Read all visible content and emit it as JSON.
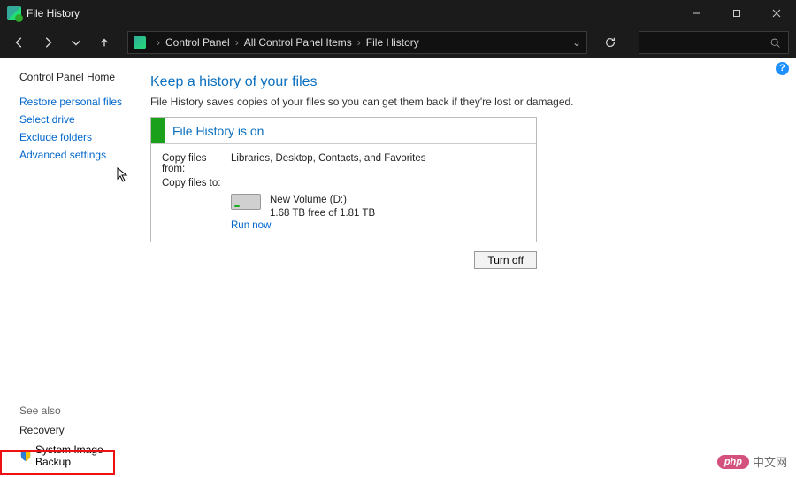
{
  "window": {
    "title": "File History"
  },
  "breadcrumb": {
    "items": [
      "Control Panel",
      "All Control Panel Items",
      "File History"
    ]
  },
  "sidebar": {
    "home": "Control Panel Home",
    "links": {
      "restore": "Restore personal files",
      "select_drive": "Select drive",
      "exclude": "Exclude folders",
      "advanced": "Advanced settings"
    },
    "see_also": "See also",
    "recovery": "Recovery",
    "sib": "System Image Backup"
  },
  "main": {
    "heading": "Keep a history of your files",
    "sub": "File History saves copies of your files so you can get them back if they're lost or damaged.",
    "status_title": "File History is on",
    "labels": {
      "from": "Copy files from:",
      "to": "Copy files to:"
    },
    "from_val": "Libraries, Desktop, Contacts, and Favorites",
    "drive_name": "New Volume (D:)",
    "drive_space": "1.68 TB free of 1.81 TB",
    "run_now": "Run now",
    "turn_off": "Turn off"
  },
  "watermark": {
    "pill": "php",
    "text": "中文网"
  }
}
